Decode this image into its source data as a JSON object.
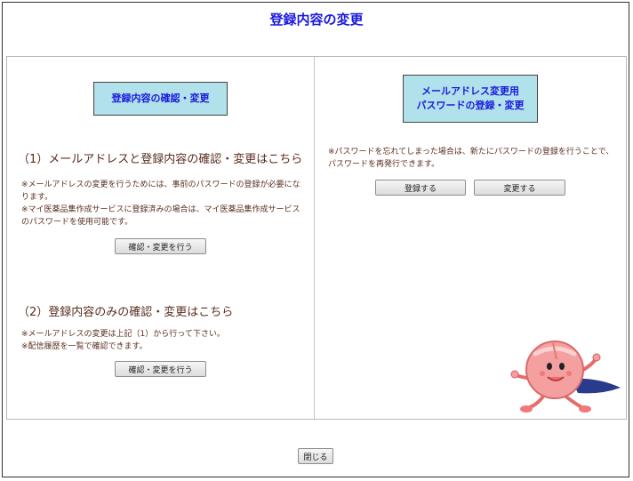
{
  "page": {
    "title": "登録内容の変更"
  },
  "left": {
    "header": "登録内容の確認・変更",
    "section1": {
      "heading": "（1）メールアドレスと登録内容の確認・変更はこちら",
      "note_lines": [
        "※メールアドレスの変更を行うためには、事前のパスワードの登録が必要にな",
        "ります。",
        "※マイ医薬品集作成サービスに登録済みの場合は、マイ医薬品集作成サービス",
        "のパスワードを使用可能です。"
      ],
      "button": "確認・変更を行う"
    },
    "section2": {
      "heading": "（2）登録内容のみの確認・変更はこちら",
      "note_lines": [
        "※メールアドレスの変更は上記（1）から行って下さい。",
        "※配信履歴を一覧で確認できます。"
      ],
      "button": "確認・変更を行う"
    }
  },
  "right": {
    "header_lines": [
      "メールアドレス変更用",
      "パスワードの登録・変更"
    ],
    "note_lines": [
      "※パスワードを忘れてしまった場合は、新たにパスワードの登録を行うことで、",
      "パスワードを再発行できます。"
    ],
    "register_button": "登録する",
    "change_button": "変更する"
  },
  "footer": {
    "close_button": "閉じる"
  },
  "colors": {
    "title": "#1a1adc",
    "header_bg": "#b1e1ea",
    "body_text": "#5a2e1e",
    "mascot_pink": "#f4a0a0",
    "mascot_cape": "#2a3a8c"
  },
  "icons": {
    "mascot": "pill-mascot-icon"
  }
}
